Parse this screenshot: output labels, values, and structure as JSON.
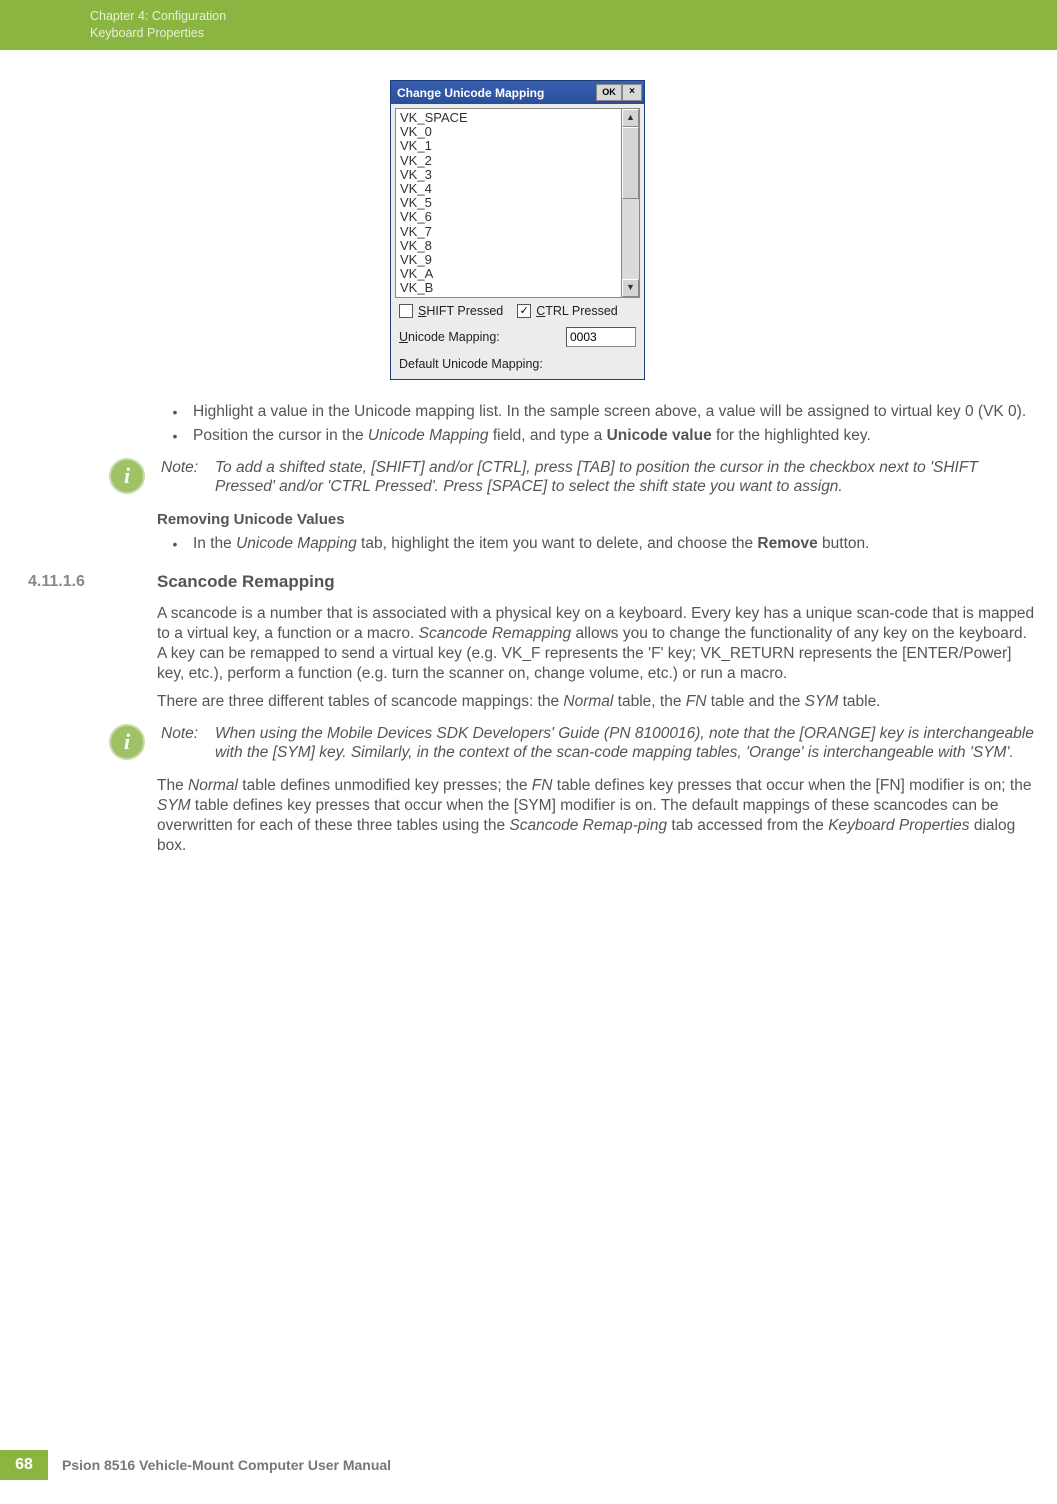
{
  "header": {
    "line1": "Chapter 4:  Configuration",
    "line2": "Keyboard Properties"
  },
  "dialog": {
    "title": "Change Unicode Mapping",
    "ok_label": "OK",
    "close_label": "×",
    "list_items": [
      "VK_SPACE",
      "VK_0",
      "VK_1",
      "VK_2",
      "VK_3",
      "VK_4",
      "VK_5",
      "VK_6",
      "VK_7",
      "VK_8",
      "VK_9",
      "VK_A",
      "VK_B"
    ],
    "shift_label_pre": "S",
    "shift_label": "HIFT Pressed",
    "ctrl_label_pre": "C",
    "ctrl_label": "TRL Pressed",
    "shift_checked": false,
    "ctrl_checked": true,
    "mapping_label_pre": "U",
    "mapping_label": "nicode Mapping:",
    "mapping_value": "0003",
    "default_label": "Default Unicode Mapping:"
  },
  "body": {
    "bullet1": "Highlight a value in the Unicode mapping list. In the sample screen above, a value will be assigned to virtual key 0 (VK 0).",
    "bullet2a": "Position the cursor in the ",
    "bullet2b": "Unicode Mapping",
    "bullet2c": " field, and type a ",
    "bullet2d": "Unicode value",
    "bullet2e": " for the highlighted key.",
    "note1_label": "Note:",
    "note1_text": "To add a shifted state, [SHIFT] and/or [CTRL], press [TAB] to position the cursor in the checkbox next to 'SHIFT Pressed' and/or 'CTRL Pressed'. Press [SPACE] to select the shift state you want to assign.",
    "removing_head": "Removing Unicode Values",
    "bullet3a": "In the ",
    "bullet3b": "Unicode Mapping",
    "bullet3c": " tab, highlight the item you want to delete, and choose the ",
    "bullet3d": "Remove",
    "bullet3e": " button.",
    "section_num": "4.11.1.6",
    "section_title": "Scancode Remapping",
    "para1a": "A scancode is a number that is associated with a physical key on a keyboard. Every key has a unique scan-code that is mapped to a virtual key, a function or a macro. ",
    "para1b": "Scancode Remapping",
    "para1c": " allows you to change the functionality of any key on the keyboard. A key can be remapped to send a virtual key (e.g. VK_F represents the 'F' key; VK_RETURN represents the [ENTER/Power] key, etc.), perform a function (e.g. turn the scanner on, change volume, etc.) or run a macro.",
    "para2a": "There are three different tables of scancode mappings: the ",
    "para2b": "Normal",
    "para2c": " table, the ",
    "para2d": "FN",
    "para2e": " table and the ",
    "para2f": "SYM",
    "para2g": " table.",
    "note2_label": "Note:",
    "note2_text": "When using the Mobile Devices SDK Developers' Guide (PN 8100016), note that the [ORANGE] key is interchangeable with the [SYM] key. Similarly, in the context of the scan-code mapping tables, 'Orange' is interchangeable with 'SYM'.",
    "para3a": "The ",
    "para3b": "Normal",
    "para3c": " table defines unmodified key presses; the ",
    "para3d": "FN",
    "para3e": " table defines key presses that occur when the [FN] modifier is on; the ",
    "para3f": "SYM",
    "para3g": " table defines key presses that occur when the [SYM] modifier is on. The default mappings of these scancodes can be overwritten for each of these three tables using the ",
    "para3h": "Scancode Remap-ping",
    "para3i": " tab accessed from the ",
    "para3j": "Keyboard Properties",
    "para3k": " dialog box."
  },
  "footer": {
    "page": "68",
    "text": "Psion 8516 Vehicle-Mount Computer User Manual"
  }
}
